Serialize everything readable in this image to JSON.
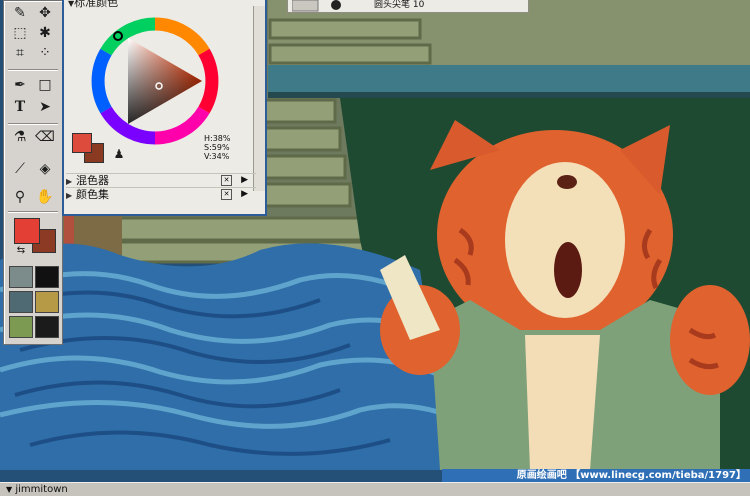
{
  "color_panel": {
    "title": "标准颜色",
    "hsv": {
      "h": "H:38%",
      "s": "S:59%",
      "v": "V:34%"
    },
    "main_color": "#dd4b3c",
    "secondary_color": "#8b3a22",
    "sub_panels": [
      {
        "label": "混色器"
      },
      {
        "label": "颜色集"
      }
    ]
  },
  "brush_bar": {
    "brush_name": "圆头尖笔 10"
  },
  "toolbox": {
    "main_color": "#e33f34",
    "secondary_color": "#8c3a24"
  },
  "status_bar": {
    "document_name": "jimmitown"
  },
  "watermark": {
    "text": "原画绘画吧 【www.linecg.com/tieba/1797】"
  },
  "icons": [
    "brush-icon",
    "crop-icon",
    "magic-wand-icon",
    "marquee-icon",
    "text-icon",
    "selector-icon",
    "eyedropper-icon",
    "eraser-icon",
    "paint-bucket-icon",
    "magnifier-icon",
    "grabber-icon",
    "swap-colors-icon"
  ]
}
